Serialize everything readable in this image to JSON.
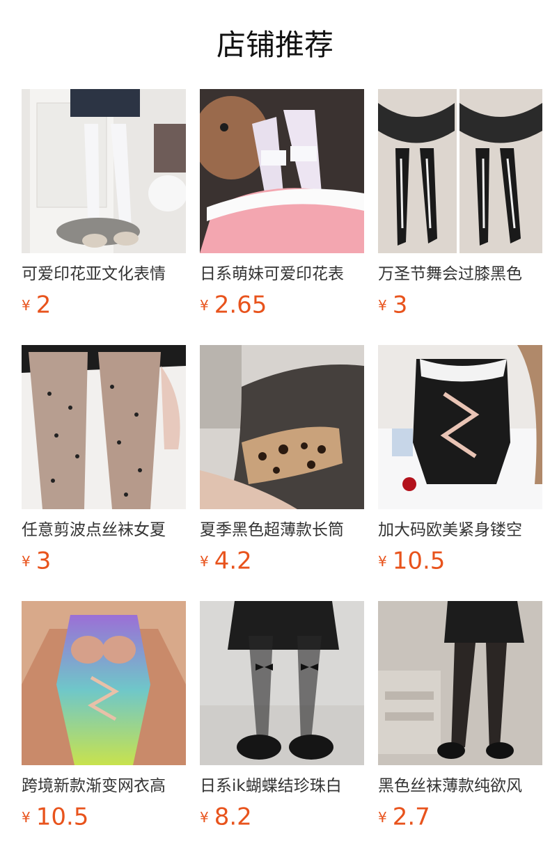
{
  "page": {
    "title": "店铺推荐"
  },
  "currency_symbol": "¥",
  "accent_color": "#e8531c",
  "products": [
    {
      "name": "可爱印花亚文化表情",
      "price": "2",
      "image": "white-stockings-photo"
    },
    {
      "name": "日系萌妹可爱印花表",
      "price": "2.65",
      "image": "pink-ruffle-stockings-photo"
    },
    {
      "name": "万圣节舞会过膝黑色",
      "price": "3",
      "image": "halloween-skeleton-stockings-photo"
    },
    {
      "name": "任意剪波点丝袜女夏",
      "price": "3",
      "image": "polka-dot-tights-photo"
    },
    {
      "name": "夏季黑色超薄款长筒",
      "price": "4.2",
      "image": "leopard-band-stockings-photo"
    },
    {
      "name": "加大码欧美紧身镂空",
      "price": "10.5",
      "image": "fishnet-bodystocking-photo"
    },
    {
      "name": "跨境新款渐变网衣高",
      "price": "10.5",
      "image": "gradient-fishnet-bodysuit-photo"
    },
    {
      "name": "日系ik蝴蝶结珍珠白",
      "price": "8.2",
      "image": "bow-sheer-tights-photo"
    },
    {
      "name": "黑色丝袜薄款纯欲风",
      "price": "2.7",
      "image": "black-sheer-tights-photo"
    }
  ]
}
